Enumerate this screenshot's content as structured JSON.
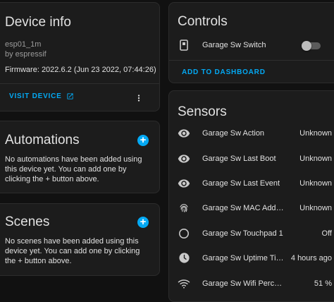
{
  "device_info": {
    "title": "Device info",
    "model": "esp01_1m",
    "manufacturer": "by espressif",
    "firmware": "Firmware: 2022.6.2 (Jun 23 2022, 07:44:26)",
    "visit_label": "VISIT DEVICE"
  },
  "automations": {
    "title": "Automations",
    "body": "No automations have been added using this device yet. You can add one by clicking the + button above."
  },
  "scenes": {
    "title": "Scenes",
    "body": "No scenes have been added using this device yet. You can add one by clicking the + button above."
  },
  "controls": {
    "title": "Controls",
    "items": [
      {
        "name": "Garage Sw Switch",
        "icon": "outlet-icon",
        "state": "off"
      }
    ],
    "add_label": "ADD TO DASHBOARD"
  },
  "sensors": {
    "title": "Sensors",
    "items": [
      {
        "name": "Garage Sw Action",
        "state": "Unknown",
        "icon": "eye-icon"
      },
      {
        "name": "Garage Sw Last Boot",
        "state": "Unknown",
        "icon": "eye-icon"
      },
      {
        "name": "Garage Sw Last Event",
        "state": "Unknown",
        "icon": "eye-icon"
      },
      {
        "name": "Garage Sw MAC Address",
        "state": "Unknown",
        "icon": "fingerprint-icon"
      },
      {
        "name": "Garage Sw Touchpad 1",
        "state": "Off",
        "icon": "circle-outline-icon"
      },
      {
        "name": "Garage Sw Uptime Tim...",
        "state": "4 hours ago",
        "icon": "clock-icon"
      },
      {
        "name": "Garage Sw Wifi Percent",
        "state": "51 %",
        "icon": "wifi-icon"
      }
    ]
  },
  "colors": {
    "accent": "#03a9f4",
    "background": "#111111",
    "card": "#1c1c1c"
  }
}
